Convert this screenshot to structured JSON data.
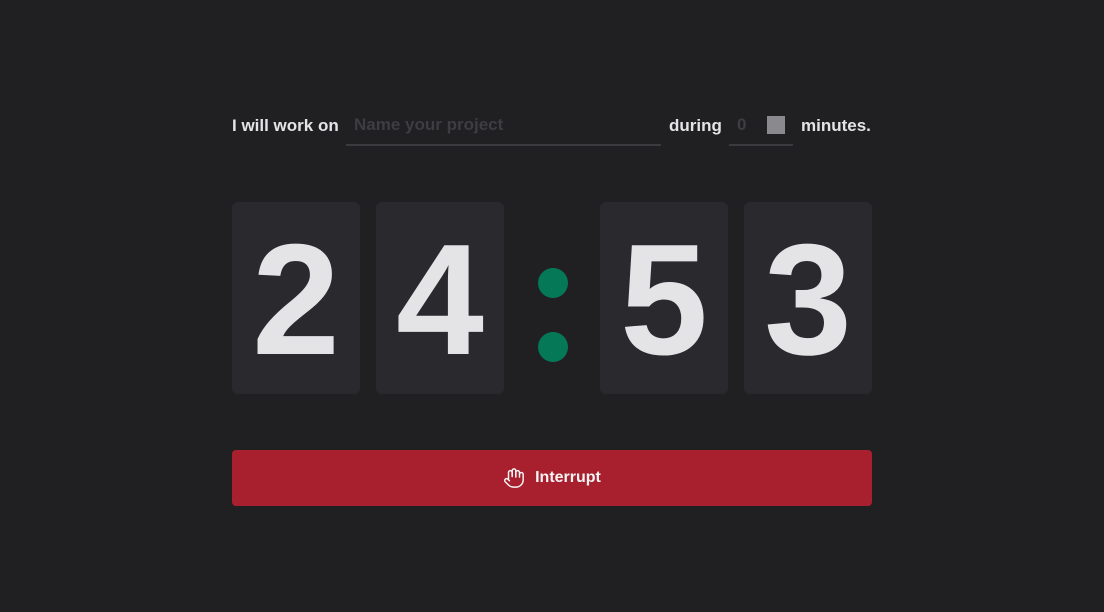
{
  "form": {
    "prefix_text": "I will work on",
    "project_value": "",
    "project_placeholder": "Name your project",
    "middle_text": "during",
    "minutes_value": "",
    "minutes_placeholder": "0",
    "suffix_text": "minutes."
  },
  "timer": {
    "digits": [
      "2",
      "4",
      "5",
      "3"
    ],
    "separator_color": "#047857"
  },
  "interrupt_button": {
    "label": "Interrupt",
    "icon": "hand-icon",
    "color": "#a8202d"
  },
  "colors": {
    "background": "#202023",
    "card": "#29292e",
    "text": "#e4e4e7"
  }
}
